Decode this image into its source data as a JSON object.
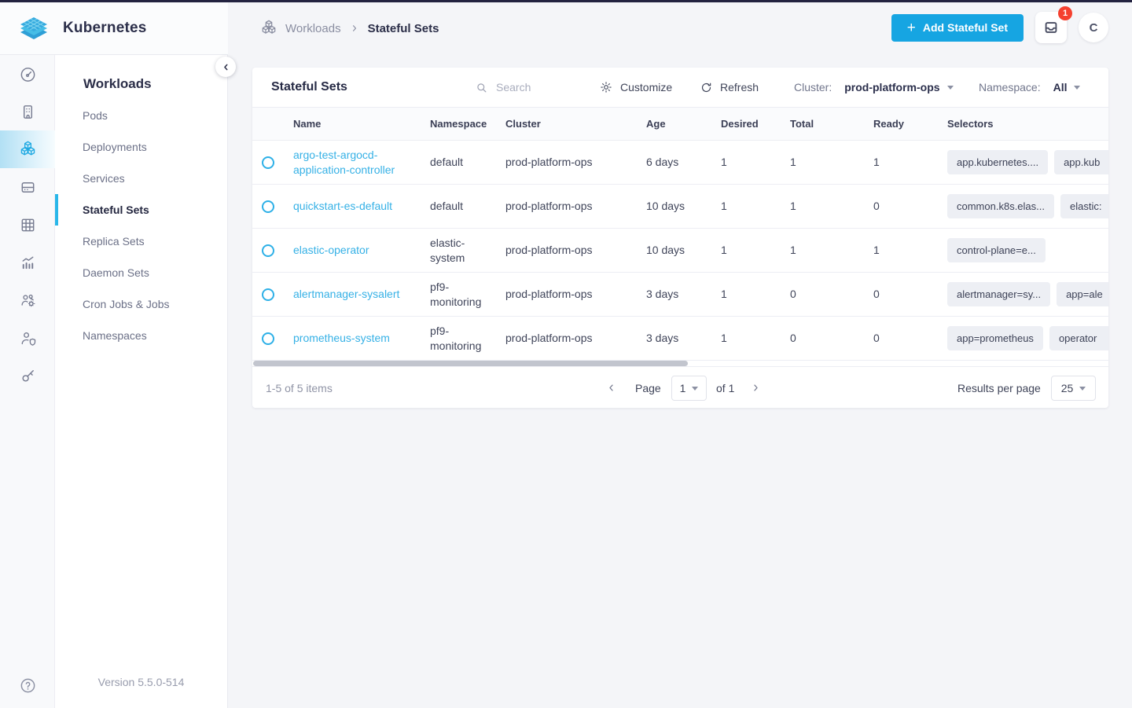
{
  "brand": {
    "app_title": "Kubernetes"
  },
  "rail": {
    "icons": [
      "dashboard",
      "infrastructure",
      "workloads",
      "storage",
      "apps",
      "monitoring",
      "user-management",
      "user-security",
      "api-access"
    ],
    "active_icon": "workloads",
    "help_icon": "help"
  },
  "sidebar": {
    "title": "Workloads",
    "items": [
      {
        "label": "Pods",
        "active": false
      },
      {
        "label": "Deployments",
        "active": false
      },
      {
        "label": "Services",
        "active": false
      },
      {
        "label": "Stateful Sets",
        "active": true
      },
      {
        "label": "Replica Sets",
        "active": false
      },
      {
        "label": "Daemon Sets",
        "active": false
      },
      {
        "label": "Cron Jobs & Jobs",
        "active": false
      },
      {
        "label": "Namespaces",
        "active": false
      }
    ],
    "version": "Version 5.5.0-514"
  },
  "breadcrumb": {
    "parent": "Workloads",
    "current": "Stateful Sets"
  },
  "header_actions": {
    "add_button": "Add Stateful Set",
    "notification_count": "1",
    "avatar_initial": "C"
  },
  "toolbar": {
    "title": "Stateful Sets",
    "search_placeholder": "Search",
    "customize": "Customize",
    "refresh": "Refresh",
    "cluster_label": "Cluster:",
    "cluster_value": "prod-platform-ops",
    "namespace_label": "Namespace:",
    "namespace_value": "All"
  },
  "table": {
    "columns": [
      "Name",
      "Namespace",
      "Cluster",
      "Age",
      "Desired",
      "Total",
      "Ready",
      "Selectors"
    ],
    "rows": [
      {
        "name": "argo-test-argocd-application-controller",
        "namespace": "default",
        "cluster": "prod-platform-ops",
        "age": "6 days",
        "desired": "1",
        "total": "1",
        "ready": "1",
        "selectors": [
          "app.kubernetes....",
          "app.kub"
        ]
      },
      {
        "name": "quickstart-es-default",
        "namespace": "default",
        "cluster": "prod-platform-ops",
        "age": "10 days",
        "desired": "1",
        "total": "1",
        "ready": "0",
        "selectors": [
          "common.k8s.elas...",
          "elastic:"
        ]
      },
      {
        "name": "elastic-operator",
        "namespace": "elastic-system",
        "cluster": "prod-platform-ops",
        "age": "10 days",
        "desired": "1",
        "total": "1",
        "ready": "1",
        "selectors": [
          "control-plane=e..."
        ]
      },
      {
        "name": "alertmanager-sysalert",
        "namespace": "pf9-monitoring",
        "cluster": "prod-platform-ops",
        "age": "3 days",
        "desired": "1",
        "total": "0",
        "ready": "0",
        "selectors": [
          "alertmanager=sy...",
          "app=ale"
        ]
      },
      {
        "name": "prometheus-system",
        "namespace": "pf9-monitoring",
        "cluster": "prod-platform-ops",
        "age": "3 days",
        "desired": "1",
        "total": "0",
        "ready": "0",
        "selectors": [
          "app=prometheus",
          "operator"
        ]
      }
    ]
  },
  "pagination": {
    "summary": "1-5 of 5 items",
    "page_label": "Page",
    "page_value": "1",
    "of_label": "of 1",
    "results_label": "Results per page",
    "results_value": "25"
  },
  "colors": {
    "accent_cyan": "#16a5e2",
    "link_cyan": "#36b1e6",
    "badge_red": "#f5402f",
    "top_bar": "#232340",
    "background": "#f4f5f8"
  }
}
